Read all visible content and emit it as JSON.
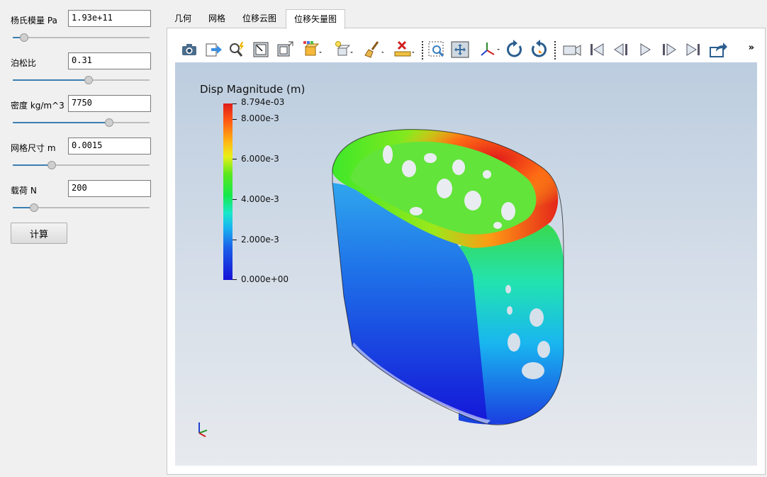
{
  "params": {
    "youngs": {
      "label": "杨氏模量 Pa",
      "value": "1.93e+11",
      "slider": 0.08
    },
    "poisson": {
      "label": "泊松比",
      "value": "0.31",
      "slider": 0.55
    },
    "density": {
      "label": "密度 kg/m^3",
      "value": "7750",
      "slider": 0.7
    },
    "mesh": {
      "label": "网格尺寸 m",
      "value": "0.0015",
      "slider": 0.28
    },
    "load": {
      "label": "载荷 N",
      "value": "200",
      "slider": 0.15
    }
  },
  "calc_button": "计算",
  "tabs": [
    {
      "label": "几何"
    },
    {
      "label": "网格"
    },
    {
      "label": "位移云图"
    },
    {
      "label": "位移矢量图",
      "active": true
    }
  ],
  "toolbar": {
    "icons": [
      "camera-icon",
      "export-icon",
      "zoom-lightning-icon",
      "reset-view-icon",
      "box-select-icon",
      "display-style-icon",
      "lighting-icon",
      "paint-brush-icon",
      "ruler-clear-icon",
      "zoom-box-icon",
      "fit-view-icon",
      "axes-orient-icon",
      "rotate-cw-icon",
      "rotate-ccw-icon",
      "video-camera-icon",
      "first-frame-icon",
      "prev-frame-icon",
      "play-icon",
      "next-frame-icon",
      "last-frame-icon",
      "share-icon"
    ],
    "more": "»"
  },
  "legend": {
    "title": "Disp Magnitude (m)",
    "labels": [
      "8.794e-03",
      "8.000e-3",
      "6.000e-3",
      "4.000e-3",
      "2.000e-3",
      "0.000e+00"
    ],
    "colors": {
      "max": "#e01b1b",
      "mid": "#16e84a",
      "min": "#1611d6"
    }
  }
}
